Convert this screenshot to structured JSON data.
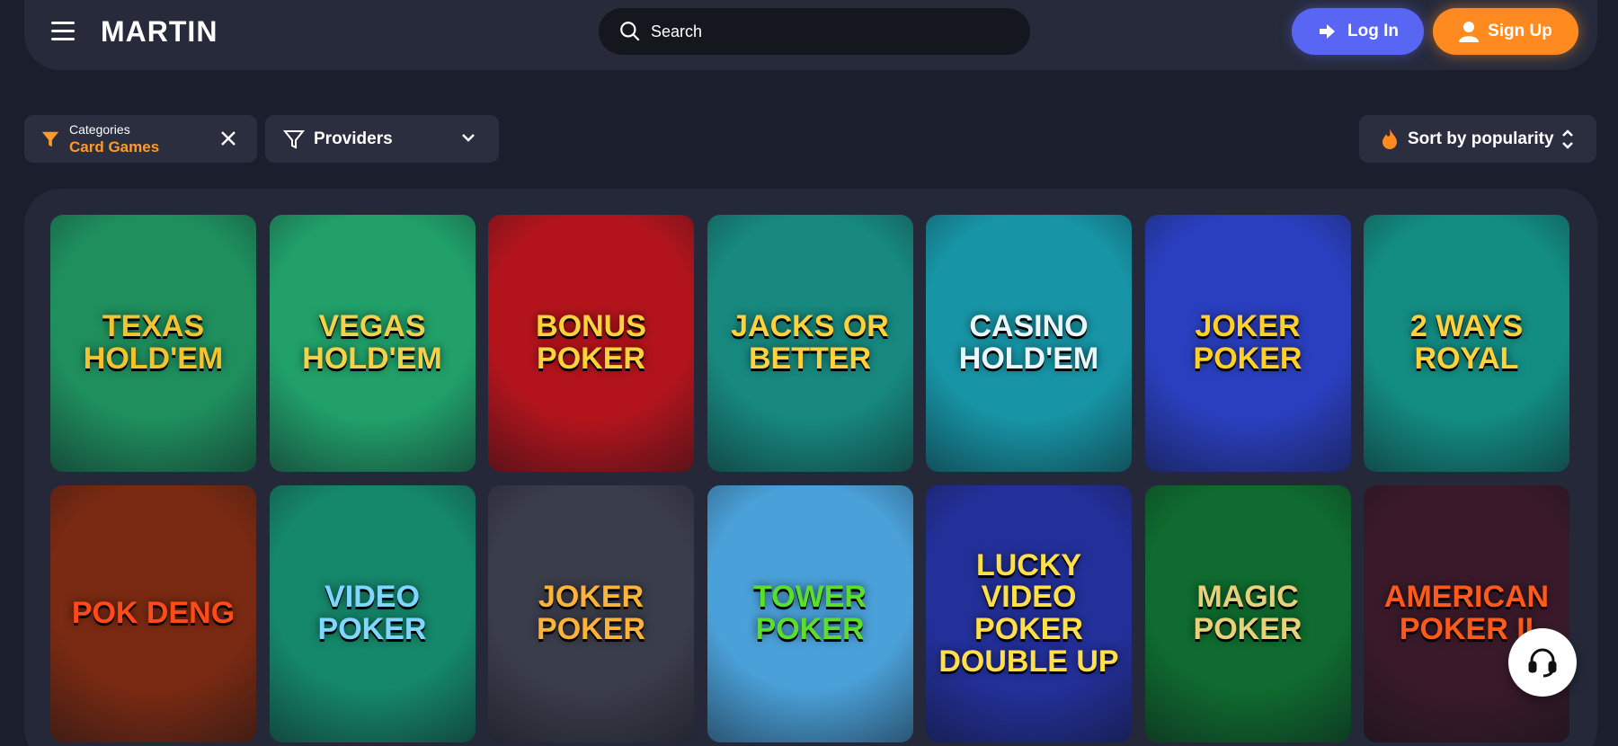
{
  "header": {
    "logo_text": "MARTIN",
    "search_placeholder": "Search",
    "login_label": "Log In",
    "signup_label": "Sign Up"
  },
  "filters": {
    "categories_label": "Categories",
    "categories_value": "Card Games",
    "providers_label": "Providers",
    "sort_label": "Sort by popularity"
  },
  "colors": {
    "background": "#1b1e2c",
    "login": "#5966f3",
    "signup": "#ff8a1f",
    "accent": "#ff9a2b"
  },
  "games": [
    {
      "name": "Texas Hold'em",
      "bg": "#1f8f5e",
      "fg": "#f4c430"
    },
    {
      "name": "Vegas Hold'em",
      "bg": "#21a06a",
      "fg": "#f2d24a"
    },
    {
      "name": "Bonus Poker",
      "bg": "#b3141c",
      "fg": "#ffd23c"
    },
    {
      "name": "Jacks or Better",
      "bg": "#17897f",
      "fg": "#ffd23c"
    },
    {
      "name": "Casino Hold'em",
      "bg": "#1795a6",
      "fg": "#e9f7fa"
    },
    {
      "name": "Joker Poker",
      "bg": "#2a3fbf",
      "fg": "#ffcf2a"
    },
    {
      "name": "2 Ways Royal",
      "bg": "#138c82",
      "fg": "#ffd23c"
    },
    {
      "name": "Pok Deng",
      "bg": "#7a2a12",
      "fg": "#ff4a1a"
    },
    {
      "name": "Video Poker",
      "bg": "#15876a",
      "fg": "#7fd7ff"
    },
    {
      "name": "Joker Poker",
      "bg": "#3a3d4a",
      "fg": "#ffb23a"
    },
    {
      "name": "Tower Poker",
      "bg": "#4aa0d8",
      "fg": "#5adf2a"
    },
    {
      "name": "Lucky Video Poker Double Up",
      "bg": "#23309a",
      "fg": "#ffe04a"
    },
    {
      "name": "Magic Poker",
      "bg": "#0f6b2f",
      "fg": "#e6d27a"
    },
    {
      "name": "American Poker II",
      "bg": "#3a1a2a",
      "fg": "#ff5a1a"
    }
  ]
}
